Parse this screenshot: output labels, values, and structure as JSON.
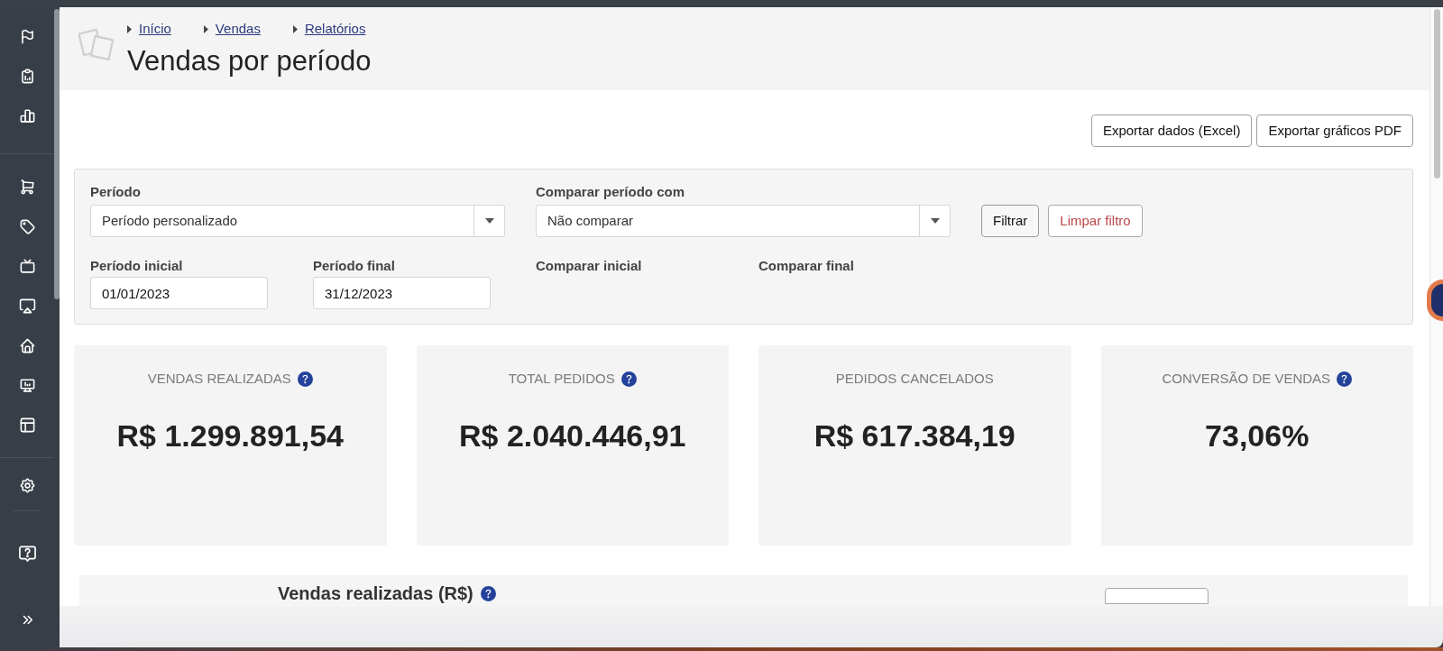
{
  "breadcrumbs": [
    {
      "label": "Início"
    },
    {
      "label": "Vendas"
    },
    {
      "label": "Relatórios"
    }
  ],
  "page_title": "Vendas por período",
  "export_buttons": [
    {
      "label": "Exportar dados (Excel)"
    },
    {
      "label": "Exportar gráficos PDF"
    }
  ],
  "filters": {
    "selects": [
      {
        "label": "Período",
        "value": "Período personalizado"
      },
      {
        "label": "Comparar período com",
        "value": "Não comparar"
      }
    ],
    "buttons": [
      {
        "label": "Filtrar",
        "kind": "default"
      },
      {
        "label": "Limpar filtro",
        "kind": "danger"
      }
    ],
    "dates": [
      {
        "label": "Período inicial",
        "value": "01/01/2023"
      },
      {
        "label": "Período final",
        "value": "31/12/2023"
      },
      {
        "label": "Comparar inicial"
      },
      {
        "label": "Comparar final"
      }
    ]
  },
  "cards": [
    {
      "label": "VENDAS REALIZADAS",
      "help": true,
      "value": "R$ 1.299.891,54"
    },
    {
      "label": "TOTAL PEDIDOS",
      "help": true,
      "value": "R$ 2.040.446,91"
    },
    {
      "label": "PEDIDOS CANCELADOS",
      "help": false,
      "value": "R$ 617.384,19"
    },
    {
      "label": "CONVERSÃO DE VENDAS",
      "help": true,
      "value": "73,06%"
    }
  ],
  "chart_section": {
    "title": "Vendas realizadas (R$)",
    "help": true
  }
}
